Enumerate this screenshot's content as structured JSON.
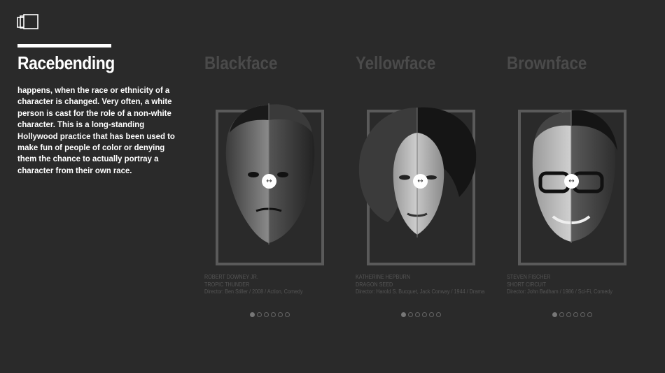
{
  "intro": {
    "title": "Racebending",
    "body": "happens, when the race or ethnicity of a character is changed. Very often, a white person is cast for the role of a non-white character. This is a long-standing Hollywood practice that has been used to make fun of people of color or denying them the chance to actually portray a character from their own race."
  },
  "columns": [
    {
      "title": "Blackface",
      "actor": "ROBERT DOWNEY JR.",
      "movie": "TROPIC THUNDER",
      "credits": "Director: Ben Stiller / 2008 / Action, Comedy",
      "icon": "compare-handle-icon",
      "dots": 6,
      "active_dot": 0
    },
    {
      "title": "Yellowface",
      "actor": "KATHERINE HEPBURN",
      "movie": "DRAGON SEED",
      "credits": "Director: Harold S. Bucquet, Jack Conway / 1944 / Drama",
      "icon": "compare-handle-icon",
      "dots": 6,
      "active_dot": 0
    },
    {
      "title": "Brownface",
      "actor": "STEVEN FISCHER",
      "movie": "SHORT CIRCUIT",
      "credits": "Director: John Badham / 1986 / Sci-Fi, Comedy",
      "icon": "compare-handle-icon",
      "dots": 6,
      "active_dot": 0
    }
  ],
  "handle_glyph": "↔",
  "colors": {
    "background": "#2a2a2a",
    "title_muted": "#4a4a4a",
    "frame": "#5a5a5a"
  }
}
